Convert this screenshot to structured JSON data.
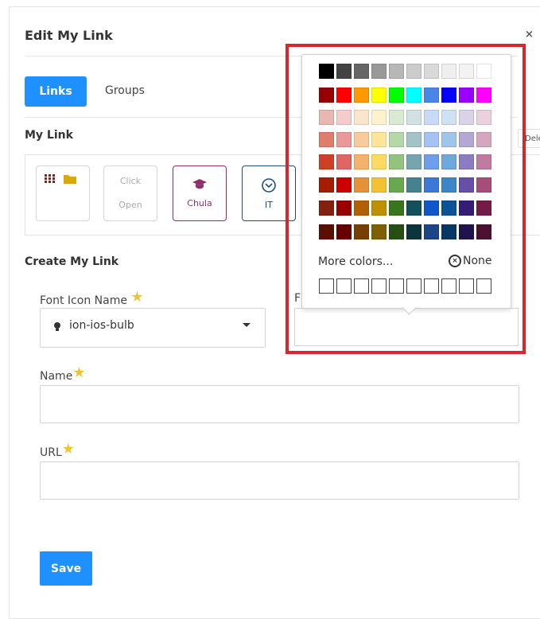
{
  "modal": {
    "title": "Edit My Link",
    "close": "×"
  },
  "tabs": [
    {
      "label": "Links"
    },
    {
      "label": "Groups"
    }
  ],
  "my_link": {
    "heading": "My Link",
    "delete_label": "Delet",
    "tiles": [
      {
        "label": "",
        "icons": [
          "grid-icon",
          "folder-icon"
        ]
      },
      {
        "label": "Click\nOpen"
      },
      {
        "label": "Chula",
        "icon": "graduation-cap-icon",
        "color": "#8e2f6d"
      },
      {
        "label": "IT",
        "icon": "chevron-circle-icon",
        "color": "#1f4e79"
      }
    ]
  },
  "create": {
    "heading": "Create My Link",
    "font_icon_label": "Font Icon Name",
    "font_icon_value": "ion-ios-bulb",
    "font_color_fragment": "F",
    "name_label": "Name",
    "url_label": "URL",
    "save_label": "Save"
  },
  "palette": {
    "rows": [
      [
        "#000000",
        "#434343",
        "#666666",
        "#999999",
        "#b7b7b7",
        "#cccccc",
        "#d9d9d9",
        "#efefef",
        "#f3f3f3",
        "#ffffff"
      ],
      [
        "#980000",
        "#ff0000",
        "#ff9900",
        "#ffff00",
        "#00ff00",
        "#00ffff",
        "#4a86e8",
        "#0000ff",
        "#9900ff",
        "#ff00ff"
      ],
      [
        "#e6b8af",
        "#f4cccc",
        "#fce5cd",
        "#fff2cc",
        "#d9ead3",
        "#d0e0e3",
        "#c9daf8",
        "#cfe2f3",
        "#d9d2e9",
        "#ead1dc"
      ],
      [
        "#dd7e6b",
        "#ea9999",
        "#f9cb9c",
        "#ffe599",
        "#b6d7a8",
        "#a2c4c9",
        "#a4c2f4",
        "#9fc5e8",
        "#b4a7d6",
        "#d5a6bd"
      ],
      [
        "#cc4125",
        "#e06666",
        "#f6b26b",
        "#ffd966",
        "#93c47d",
        "#76a5af",
        "#6d9eeb",
        "#6fa8dc",
        "#8e7cc3",
        "#c27ba0"
      ],
      [
        "#a61c00",
        "#cc0000",
        "#e69138",
        "#f1c232",
        "#6aa84f",
        "#45818e",
        "#3c78d8",
        "#3d85c6",
        "#674ea7",
        "#a64d79"
      ],
      [
        "#85200c",
        "#990000",
        "#b45f06",
        "#bf9000",
        "#38761d",
        "#134f5c",
        "#1155cc",
        "#0b5394",
        "#351c75",
        "#741b47"
      ],
      [
        "#5b0f00",
        "#660000",
        "#783f04",
        "#7f6000",
        "#274e13",
        "#0c343d",
        "#1c4587",
        "#073763",
        "#20124d",
        "#4c1130"
      ]
    ],
    "more_colors": "More colors...",
    "none_label": "None",
    "recent_count": 10
  }
}
